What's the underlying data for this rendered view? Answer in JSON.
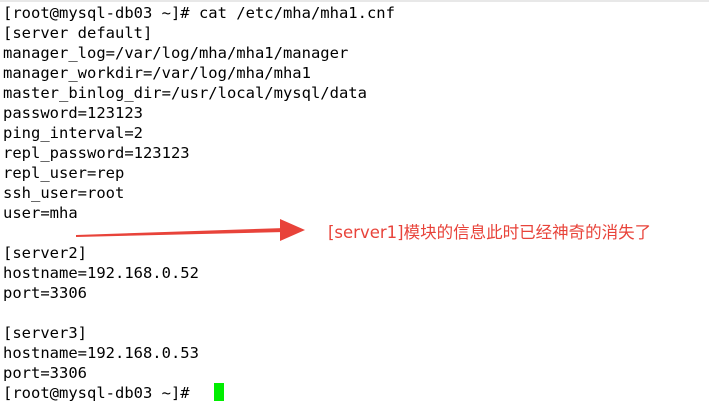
{
  "terminal": {
    "background": "#ffffff",
    "text_color": "#000000",
    "cursor_color": "#00ee00",
    "lines": [
      "[root@mysql-db03 ~]# cat /etc/mha/mha1.cnf",
      "[server default]",
      "manager_log=/var/log/mha/mha1/manager",
      "manager_workdir=/var/log/mha/mha1",
      "master_binlog_dir=/usr/local/mysql/data",
      "password=123123",
      "ping_interval=2",
      "repl_password=123123",
      "repl_user=rep",
      "ssh_user=root",
      "user=mha",
      "",
      "[server2]",
      "hostname=192.168.0.52",
      "port=3306",
      "",
      "[server3]",
      "hostname=192.168.0.53",
      "port=3306",
      "[root@mysql-db03 ~]# "
    ]
  },
  "annotation": {
    "text": "[server1]模块的信息此时已经神奇的消失了",
    "color": "#e8433a"
  }
}
